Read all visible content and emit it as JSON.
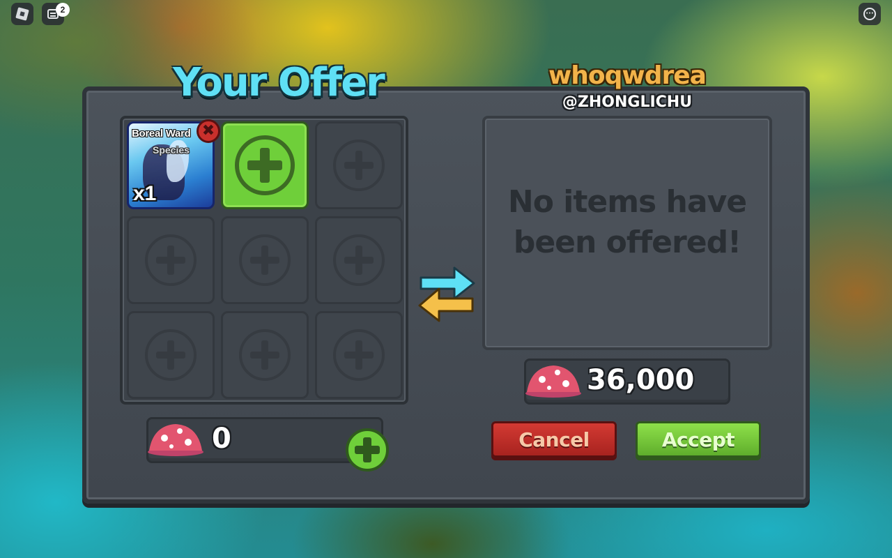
{
  "topbar": {
    "chat_badge": "2",
    "more_glyph": "···"
  },
  "trade": {
    "your_offer_title": "Your Offer",
    "partner_display_name": "whoqwdrea",
    "partner_username": "@ZHONGLICHU",
    "empty_message_line1": "No items have",
    "empty_message_line2": "been offered!",
    "remove_glyph": "✖"
  },
  "your_items": [
    {
      "name": "Boreal Ward",
      "type": "Species",
      "quantity": "x1"
    }
  ],
  "currency": {
    "icon": "mushroom-icon",
    "your_amount": "0",
    "partner_amount": "36,000"
  },
  "buttons": {
    "cancel_label": "Cancel",
    "accept_label": "Accept"
  },
  "colors": {
    "title_cyan": "#5fe0f5",
    "partner_name_orange": "#f2b34a",
    "accept_green": "#6fcf3a",
    "cancel_red": "#c9302c"
  }
}
